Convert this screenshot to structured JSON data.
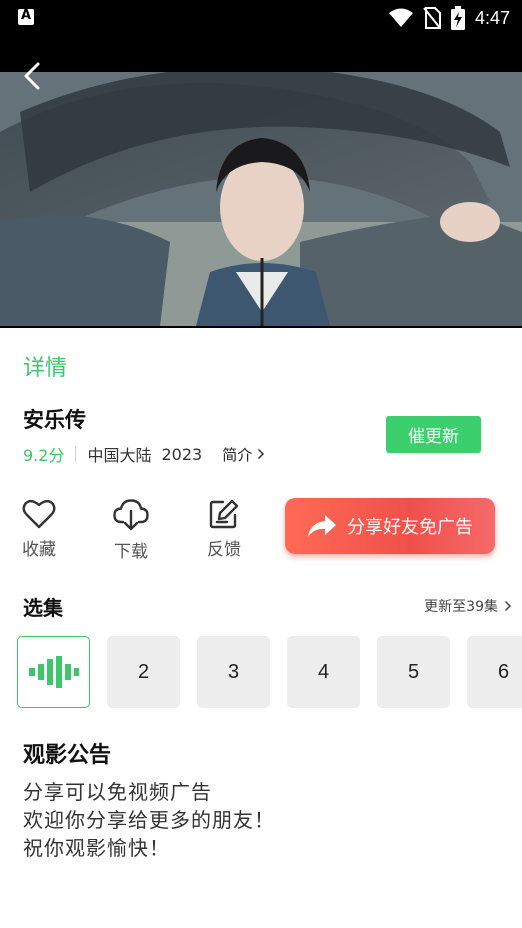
{
  "status_bar": {
    "time": "4:47",
    "icons": [
      "app-notification-icon",
      "wifi-icon",
      "no-sim-icon",
      "battery-charging-icon"
    ]
  },
  "player": {
    "back_icon": "chevron-left-icon"
  },
  "detail": {
    "tab_label": "详情",
    "title": "安乐传",
    "score": "9.2分",
    "region": "中国大陆",
    "year": "2023",
    "intro_label": "简介",
    "urge_button": "催更新"
  },
  "actions": [
    {
      "label": "收藏",
      "icon": "heart-icon"
    },
    {
      "label": "下载",
      "icon": "cloud-download-icon"
    },
    {
      "label": "反馈",
      "icon": "edit-icon"
    }
  ],
  "share_button": {
    "label": "分享好友免广告",
    "icon": "share-arrow-icon",
    "color": "#f0504a"
  },
  "episodes": {
    "title": "选集",
    "update_text": "更新至39集",
    "items": [
      "",
      "2",
      "3",
      "4",
      "5",
      "6"
    ],
    "active_icon": "playing-bars-icon"
  },
  "notice": {
    "title": "观影公告",
    "lines": [
      "分享可以免视频广告",
      "欢迎你分享给更多的朋友！",
      "祝你观影愉快！"
    ]
  },
  "colors": {
    "accent": "#3cc76a",
    "share": "#f0504a"
  }
}
